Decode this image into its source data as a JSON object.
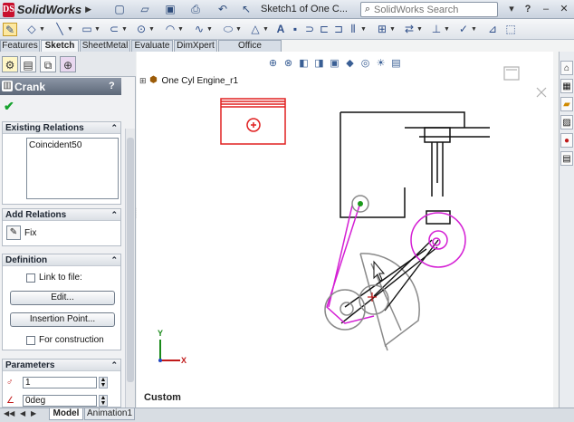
{
  "app": {
    "name": "SolidWorks",
    "logo_text": "DS"
  },
  "titlebar": {
    "document_title": "Sketch1 of One C...",
    "search_placeholder": "SolidWorks Search",
    "search_dropdown": "▾",
    "help": "?",
    "minimize": "–",
    "close": "✕"
  },
  "tabs": [
    {
      "label": "Features"
    },
    {
      "label": "Sketch",
      "active": true
    },
    {
      "label": "SheetMetal"
    },
    {
      "label": "Evaluate"
    },
    {
      "label": "DimXpert"
    },
    {
      "label": "Office Products"
    }
  ],
  "property_manager": {
    "title": "Crank",
    "help": "?",
    "ok": "✔",
    "existing_relations": {
      "heading": "Existing Relations",
      "items": [
        "Coincident50"
      ]
    },
    "add_relations": {
      "heading": "Add Relations",
      "fix_label": "Fix"
    },
    "definition": {
      "heading": "Definition",
      "link_to_file": "Link to file:",
      "edit_button": "Edit...",
      "insertion_point_button": "Insertion Point...",
      "for_construction": "For construction"
    },
    "parameters": {
      "heading": "Parameters",
      "count_value": "1",
      "angle_value": "0deg"
    }
  },
  "tree": {
    "root": "One Cyl Engine_r1"
  },
  "graphics": {
    "view_label": "Custom",
    "axis_x": "X",
    "axis_y": "Y"
  },
  "bottom_tabs": [
    {
      "label": "Model"
    },
    {
      "label": "Animation1"
    }
  ],
  "icons": {
    "toolbar": [
      "new-icon",
      "open-icon",
      "save-icon",
      "print-icon",
      "undo-icon",
      "select-icon",
      "traffic-light-icon"
    ],
    "command": [
      "sketch-icon",
      "smart-dimension-icon",
      "line-icon",
      "rectangle-icon",
      "circle-icon",
      "arc-icon",
      "spline-icon",
      "ellipse-icon",
      "text-icon",
      "point-icon",
      "trim-icon",
      "convert-icon",
      "offset-icon",
      "mirror-icon",
      "pattern-icon",
      "move-icon",
      "relations-icon",
      "repair-icon",
      "rapid-sketch-icon",
      "sketch-3d-icon"
    ],
    "heads_up": [
      "zoom-fit-icon",
      "zoom-area-icon",
      "previous-view-icon",
      "section-view-icon",
      "view-orientation-icon",
      "display-style-icon",
      "hide-show-icon",
      "appearance-icon",
      "scene-icon"
    ]
  },
  "colors": {
    "block_magenta": "#d41fd4",
    "block_red": "#e02020",
    "sketch_black": "#111111",
    "sketch_gray": "#8a8a8a",
    "selected_green": "#1a9a1a"
  }
}
